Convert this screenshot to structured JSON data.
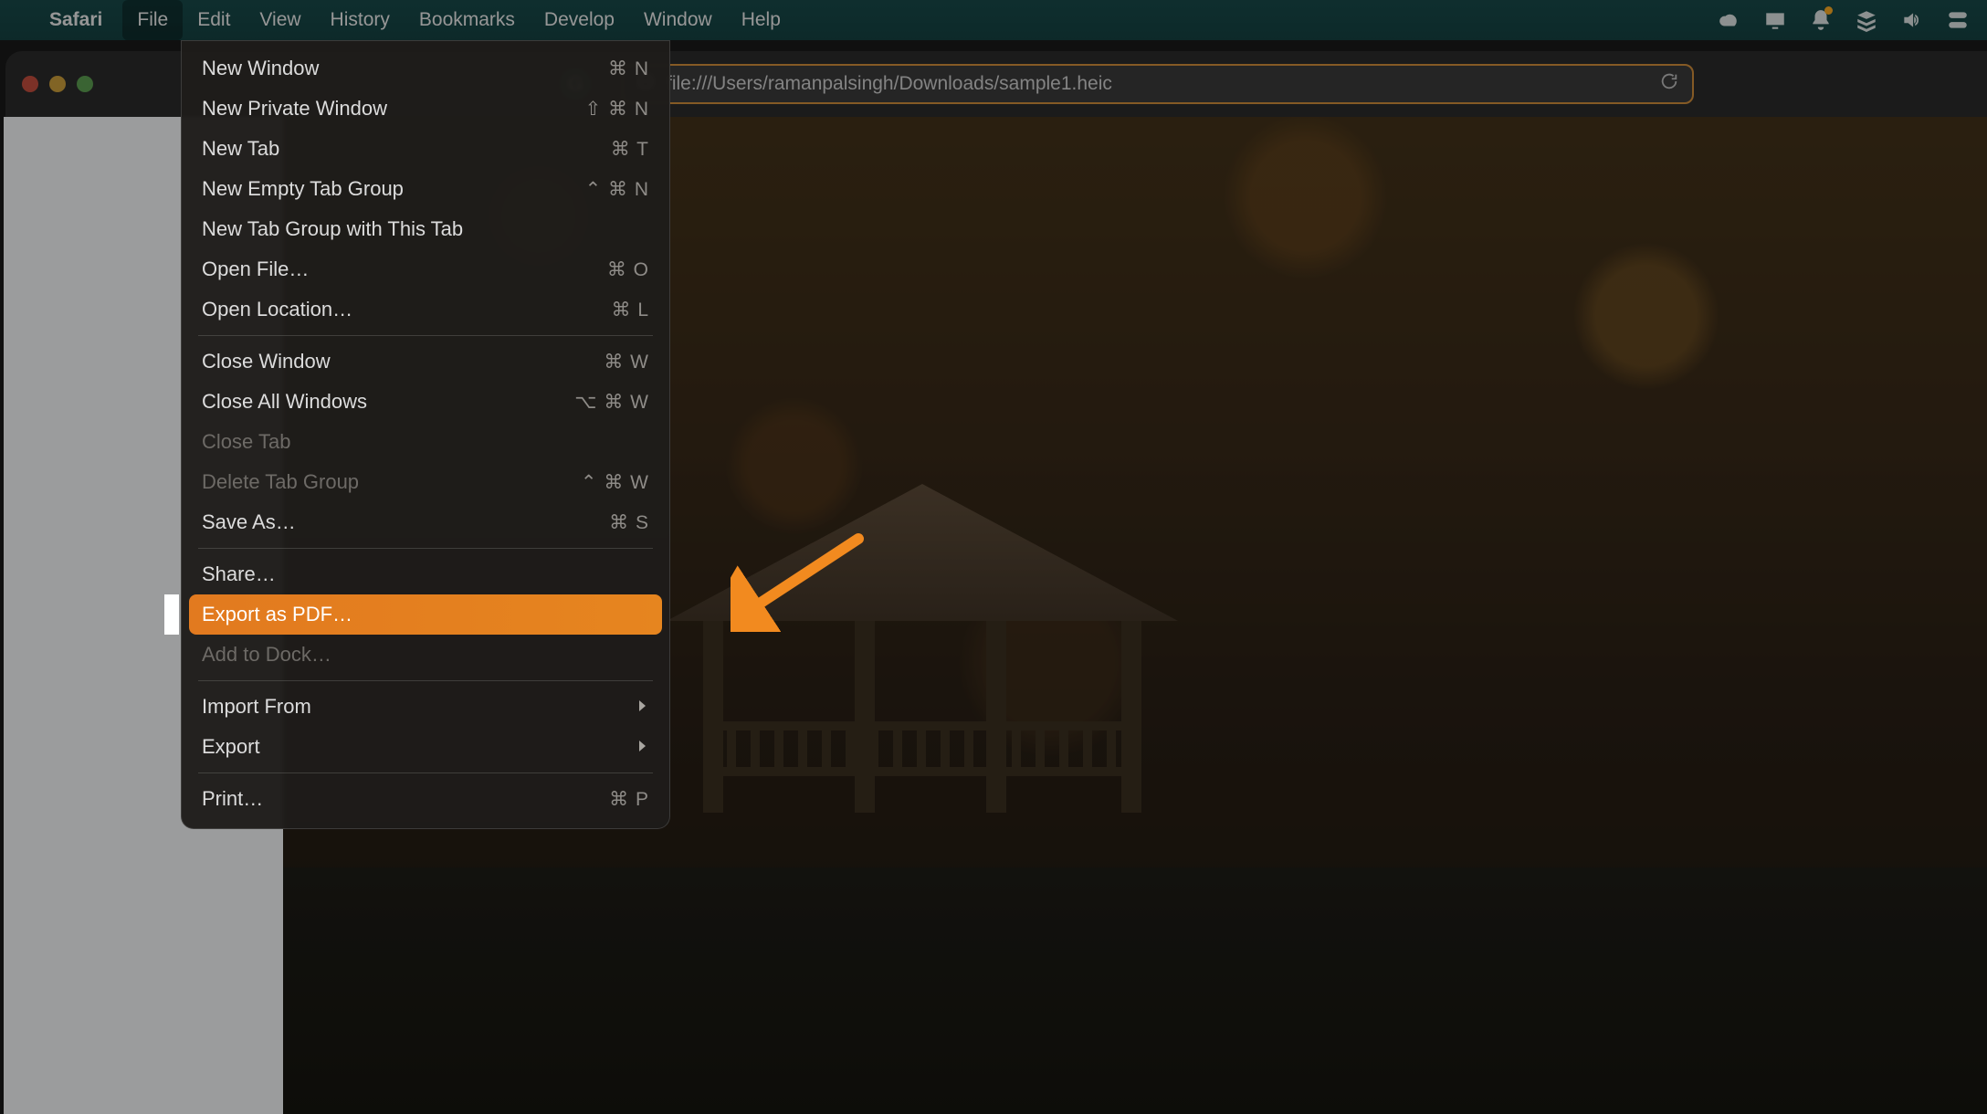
{
  "menubar": {
    "app": "Safari",
    "items": [
      "File",
      "Edit",
      "View",
      "History",
      "Bookmarks",
      "Develop",
      "Window",
      "Help"
    ],
    "active_index": 0,
    "status_icons": [
      "creative-cloud-icon",
      "display-icon",
      "notifications-icon",
      "stack-icon",
      "volume-icon",
      "control-center-icon"
    ]
  },
  "toolbar": {
    "url": "file:///Users/ramanpalsingh/Downloads/sample1.heic"
  },
  "file_menu": {
    "groups": [
      [
        {
          "label": "New Window",
          "shortcut": "⌘ N"
        },
        {
          "label": "New Private Window",
          "shortcut": "⇧ ⌘ N"
        },
        {
          "label": "New Tab",
          "shortcut": "⌘ T"
        },
        {
          "label": "New Empty Tab Group",
          "shortcut": "⌃ ⌘ N"
        },
        {
          "label": "New Tab Group with This Tab",
          "shortcut": ""
        },
        {
          "label": "Open File…",
          "shortcut": "⌘ O"
        },
        {
          "label": "Open Location…",
          "shortcut": "⌘ L"
        }
      ],
      [
        {
          "label": "Close Window",
          "shortcut": "⌘ W"
        },
        {
          "label": "Close All Windows",
          "shortcut": "⌥ ⌘ W"
        },
        {
          "label": "Close Tab",
          "shortcut": "",
          "disabled": true
        },
        {
          "label": "Delete Tab Group",
          "shortcut": "⌃ ⌘ W",
          "disabled": true
        },
        {
          "label": "Save As…",
          "shortcut": "⌘ S"
        }
      ],
      [
        {
          "label": "Share…",
          "shortcut": ""
        },
        {
          "label": "Export as PDF…",
          "shortcut": "",
          "highlight": true
        },
        {
          "label": "Add to Dock…",
          "shortcut": "",
          "disabled": true
        }
      ],
      [
        {
          "label": "Import From",
          "shortcut": "",
          "submenu": true
        },
        {
          "label": "Export",
          "shortcut": "",
          "submenu": true
        }
      ],
      [
        {
          "label": "Print…",
          "shortcut": "⌘ P"
        }
      ]
    ]
  },
  "annotation": {
    "arrow_color": "#f28a1f"
  }
}
